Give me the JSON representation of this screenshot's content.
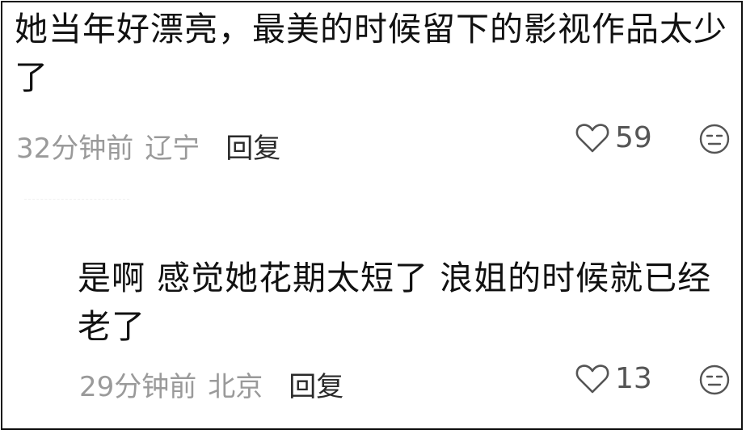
{
  "comments": [
    {
      "text": "她当年好漂亮，最美的时候留下的影视作品太少了",
      "time": "32分钟前",
      "location": "辽宁",
      "reply_label": "回复",
      "likes": "59"
    },
    {
      "text": "是啊 感觉她花期太短了 浪姐的时候就已经老了",
      "time": "29分钟前",
      "location": "北京",
      "reply_label": "回复",
      "likes": "13"
    }
  ],
  "icons": {
    "like": "heart-outline-icon",
    "reaction": "neutral-face-icon"
  },
  "colors": {
    "text": "#111111",
    "meta": "#9a9a9a",
    "reply": "#2a2a2a",
    "icon": "#555555"
  }
}
